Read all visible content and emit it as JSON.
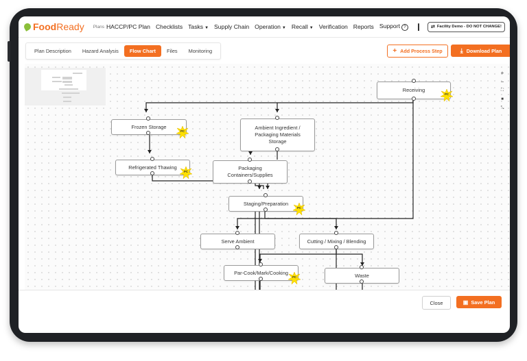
{
  "header": {
    "logo_food": "Food",
    "logo_ready": "Ready",
    "plans_label": "Plans",
    "current_plan": "HACCP/PC Plan",
    "nav": [
      {
        "label": "Checklists",
        "caret": false
      },
      {
        "label": "Tasks",
        "caret": true
      },
      {
        "label": "Supply Chain",
        "caret": false
      },
      {
        "label": "Operation",
        "caret": true
      },
      {
        "label": "Recall",
        "caret": true
      },
      {
        "label": "Verification",
        "caret": false
      },
      {
        "label": "Reports",
        "caret": false
      },
      {
        "label": "Support",
        "caret": false
      }
    ],
    "facility": "Facility Demo - DO NOT CHANGE!"
  },
  "tabs": [
    {
      "label": "Plan Description",
      "active": false
    },
    {
      "label": "Hazard Analysis",
      "active": false
    },
    {
      "label": "Flow Chart",
      "active": true
    },
    {
      "label": "Files",
      "active": false
    },
    {
      "label": "Monitoring",
      "active": false
    }
  ],
  "actions": {
    "add_process_step": "Add Process Step",
    "download_plan": "Download Plan",
    "close": "Close",
    "save_plan": "Save Plan"
  },
  "zoom_controls": [
    "+",
    "−",
    "⛶",
    "🔒",
    "⤡"
  ],
  "badge_label": "PC",
  "flow": {
    "nodes": [
      {
        "id": "receiving",
        "label": "Receiving",
        "pc": true
      },
      {
        "id": "frozen",
        "label": "Frozen Storage",
        "pc": true
      },
      {
        "id": "ambient",
        "label": "Ambient Ingredient / Packaging Materials Storage",
        "pc": false
      },
      {
        "id": "thawing",
        "label": "Refrigerated Thawing",
        "pc": true
      },
      {
        "id": "packaging",
        "label": "Packaging Containers/Supplies",
        "pc": false
      },
      {
        "id": "staging",
        "label": "Staging/Preparation",
        "pc": true
      },
      {
        "id": "serve",
        "label": "Serve Ambient",
        "pc": false
      },
      {
        "id": "cutting",
        "label": "Cutting / Mixing / Blending",
        "pc": false
      },
      {
        "id": "parcook",
        "label": "Par-Cook/Mark/Cooking",
        "pc": true
      },
      {
        "id": "waste",
        "label": "Waste",
        "pc": false
      }
    ]
  },
  "colors": {
    "accent": "#f36f21",
    "badge": "#ffe000",
    "edge": "#222222"
  }
}
